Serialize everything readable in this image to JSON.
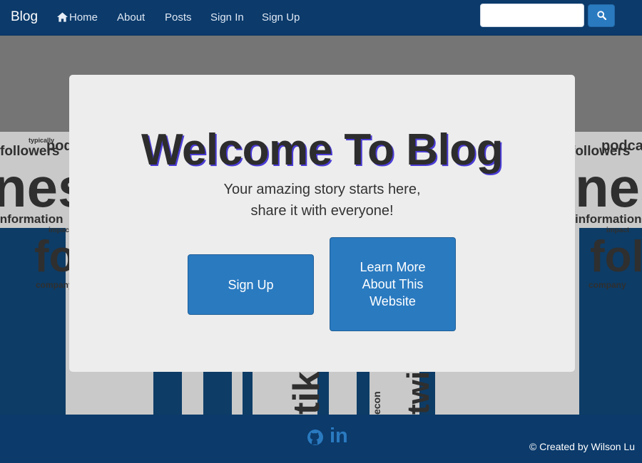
{
  "navbar": {
    "brand": "Blog",
    "items": [
      {
        "label": "Home",
        "icon": "home-icon"
      },
      {
        "label": "About"
      },
      {
        "label": "Posts"
      },
      {
        "label": "Sign In"
      },
      {
        "label": "Sign Up"
      }
    ],
    "search": {
      "value": "",
      "icon": "search-icon"
    }
  },
  "hero": {
    "title": "Welcome To Blog",
    "subtitle_line1": "Your amazing story starts here,",
    "subtitle_line2": "share it with everyone!",
    "signup_label": "Sign Up",
    "learn_more_label": "Learn More About This Website"
  },
  "background_words": {
    "w1": "followers",
    "w2": "podcasts",
    "w3": "typically",
    "w4": "ness",
    "w5": "information",
    "w6": "impact",
    "w7": "fol",
    "w8": "company",
    "w9": "twi",
    "w10": "econ",
    "w11": "tik",
    "w12": "custo"
  },
  "footer": {
    "icons": [
      "github-icon",
      "linkedin-icon"
    ],
    "linkedin_text": "in",
    "copyright": "© Created by Wilson Lu"
  },
  "colors": {
    "navbar": "#0b3a6b",
    "accent": "#2a7ac0",
    "card": "#ededed",
    "title_shadow": "#4a3cd6"
  }
}
